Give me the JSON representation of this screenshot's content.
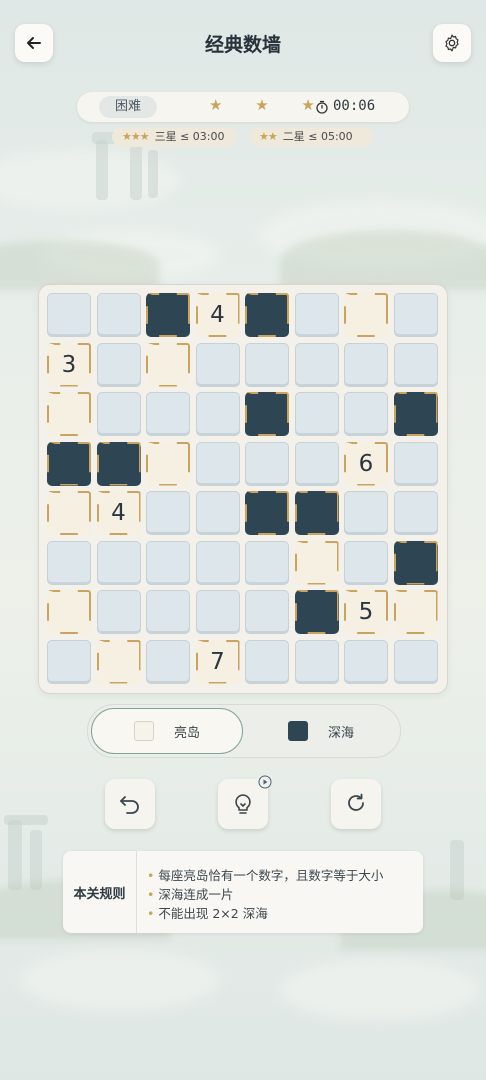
{
  "header": {
    "title": "经典数墙"
  },
  "status": {
    "difficulty": "困难",
    "stars": "★ ★ ★",
    "timer": "00:06"
  },
  "goals": [
    {
      "stars": "★★★",
      "label": "三星 ≤ 03:00"
    },
    {
      "stars": "★★",
      "label": "二星 ≤ 05:00"
    }
  ],
  "board": {
    "size": 8,
    "legend": "u = unknown, i = island, s = sea",
    "rows": [
      [
        "u",
        "u",
        "s",
        "i",
        "s",
        "u",
        "i",
        "u"
      ],
      [
        "i",
        "u",
        "i",
        "u",
        "u",
        "u",
        "u",
        "u"
      ],
      [
        "i",
        "u",
        "u",
        "u",
        "s",
        "u",
        "u",
        "s"
      ],
      [
        "s",
        "s",
        "i",
        "u",
        "u",
        "u",
        "i",
        "u"
      ],
      [
        "i",
        "i",
        "u",
        "u",
        "s",
        "s",
        "u",
        "u"
      ],
      [
        "u",
        "u",
        "u",
        "u",
        "u",
        "i",
        "u",
        "s"
      ],
      [
        "i",
        "u",
        "u",
        "u",
        "u",
        "s",
        "i",
        "i"
      ],
      [
        "u",
        "i",
        "u",
        "i",
        "u",
        "u",
        "u",
        "u"
      ]
    ],
    "numbers": [
      [
        "",
        "",
        "",
        "4",
        "",
        "",
        "",
        ""
      ],
      [
        "3",
        "",
        "",
        "",
        "",
        "",
        "",
        ""
      ],
      [
        "",
        "",
        "",
        "",
        "",
        "",
        "",
        ""
      ],
      [
        "",
        "",
        "",
        "",
        "",
        "",
        "6",
        ""
      ],
      [
        "",
        "4",
        "",
        "",
        "",
        "",
        "",
        ""
      ],
      [
        "",
        "",
        "",
        "",
        "",
        "",
        "",
        ""
      ],
      [
        "",
        "",
        "",
        "",
        "",
        "",
        "5",
        ""
      ],
      [
        "",
        "",
        "",
        "7",
        "",
        "",
        "",
        ""
      ]
    ]
  },
  "mode_toggle": {
    "island_label": "亮岛",
    "sea_label": "深海",
    "selected": "亮岛"
  },
  "actions": {
    "undo_icon": "undo-icon",
    "hint_icon": "lightbulb-icon",
    "reset_icon": "refresh-icon"
  },
  "rules": {
    "title": "本关规则",
    "items": [
      "每座亮岛恰有一个数字，且数字等于大小",
      "深海连成一片",
      "不能出现 2×2 深海"
    ]
  },
  "colors": {
    "sea": "#2e4654",
    "island": "#f6f0e3",
    "unknown": "#dde6ea",
    "gold": "#caa45e",
    "accent": "#7fa59b"
  }
}
